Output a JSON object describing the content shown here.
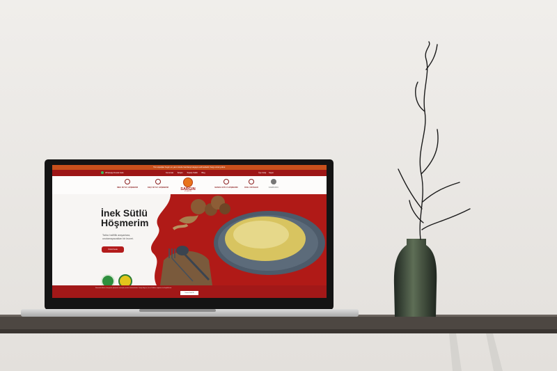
{
  "site": {
    "topbar_text": "Tüm siparişler bugün ve yarın özenle hazırlanıp kargoya verilmektedir. Kargo ücreti yoktur.",
    "whatsapp": "Whatsapp Destek Hattı",
    "nav_links": [
      "Kurumsal",
      "İletişim",
      "Sipariş Takibi",
      "Blog"
    ],
    "account_links": [
      "Üye Girişi",
      "Sepet"
    ],
    "categories": [
      "İNEK SÜTLÜ HÖŞMERİM",
      "KEÇİ SÜTLÜ HÖŞMERİM",
      "MANDA SÜTLÜ HÖŞMERİM",
      "ÖZEL ÜRÜNLER",
      "KAMPANYA"
    ],
    "logo": {
      "brand": "SARGIN",
      "sub": "HÖŞMERİM"
    },
    "hero": {
      "title_line1": "İnek Sütlü",
      "title_line2": "Höşmerim",
      "subtitle": "Tatlıcı halifilik arayanlara, unutamayacakları bir lezzet.",
      "button": "Ürünü İncele"
    },
    "cookie": {
      "text": "Sitemizde kullanıcı deneyimini iyileştirmek amacıyla çerezler kullanılmaktadır. Detaylı bilgi için Çerez Politikası sayfamızı inceleyebilirsiniz.",
      "button": "Tamam Kabul Et"
    }
  },
  "colors": {
    "brand_red": "#a21818",
    "accent_orange": "#c8501c",
    "wall": "#ebe8e4",
    "shelf": "#4d4742"
  },
  "icons": [
    "whatsapp-icon",
    "cow-icon",
    "goat-icon",
    "buffalo-icon",
    "special-product-icon",
    "campaign-icon",
    "certificate-icon"
  ]
}
